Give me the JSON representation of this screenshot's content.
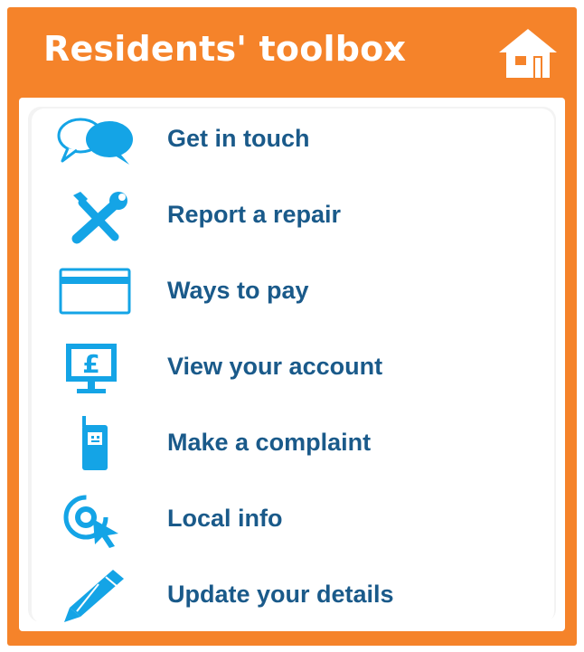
{
  "header": {
    "title": "Residents' toolbox",
    "home_icon": "home-icon"
  },
  "colors": {
    "brand_orange": "#f5832a",
    "icon_blue": "#14a4e6",
    "label_blue": "#1a5a8a",
    "panel_bg": "#ffffff"
  },
  "menu": {
    "items": [
      {
        "label": "Get in touch",
        "icon": "speech-bubbles-icon"
      },
      {
        "label": "Report a repair",
        "icon": "wrench-screwdriver-icon"
      },
      {
        "label": "Ways to pay",
        "icon": "payment-card-icon"
      },
      {
        "label": "View your account",
        "icon": "pound-monitor-icon"
      },
      {
        "label": "Make a complaint",
        "icon": "mobile-phone-icon"
      },
      {
        "label": "Local info",
        "icon": "target-cursor-icon"
      },
      {
        "label": "Update your details",
        "icon": "pencil-icon"
      }
    ]
  }
}
